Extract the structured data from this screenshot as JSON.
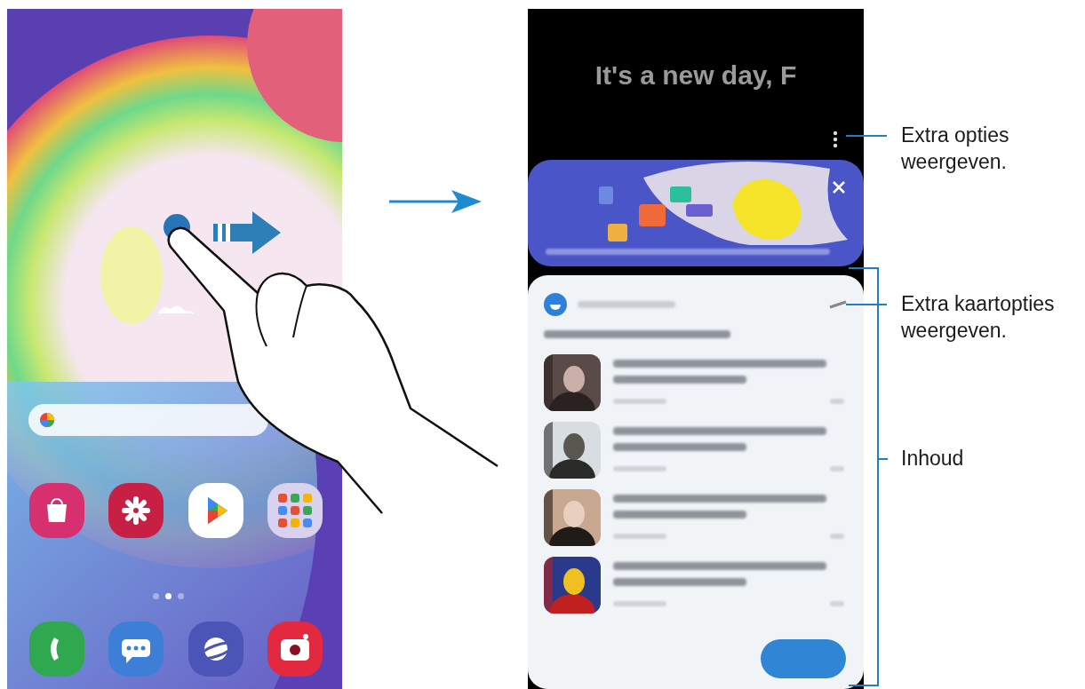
{
  "left_screen": {
    "kind": "home_screen",
    "page_dots": [
      {
        "selected": false
      },
      {
        "selected": true
      },
      {
        "selected": false
      }
    ]
  },
  "right_screen": {
    "greeting": "It's a new day, F"
  },
  "callouts": [
    {
      "kind": "line",
      "label": "Extra opties weergeven."
    },
    {
      "kind": "line",
      "label": "Extra kaartopties weergeven."
    },
    {
      "kind": "bracket",
      "label": "Inhoud"
    }
  ]
}
